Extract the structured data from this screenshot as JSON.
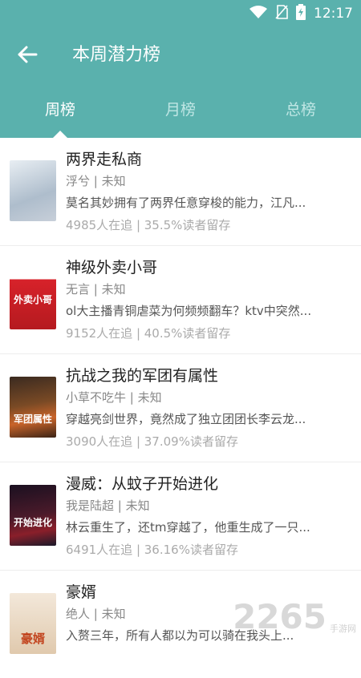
{
  "status_bar": {
    "time": "12:17",
    "icons": [
      "wifi-icon",
      "no-sim-icon",
      "battery-charging-icon"
    ]
  },
  "header": {
    "title": "本周潜力榜",
    "back_icon": "back-arrow-icon"
  },
  "tabs": [
    {
      "label": "周榜",
      "active": true
    },
    {
      "label": "月榜",
      "active": false
    },
    {
      "label": "总榜",
      "active": false
    }
  ],
  "books": [
    {
      "title": "两界走私商",
      "author": "浮兮 | 未知",
      "desc": "莫名其妙拥有了两界任意穿梭的能力，江凡...",
      "stats": "4985人在追 |  35.5%读者留存",
      "cover_text": "",
      "cover_color": "#c9d3dc"
    },
    {
      "title": "神级外卖小哥",
      "author": "无言 | 未知",
      "desc": "ol大主播青铜虐菜为何频频翻车？ktv中突然...",
      "stats": "9152人在追 |  40.5%读者留存",
      "cover_text": "外卖小哥",
      "cover_color": "#d7222a"
    },
    {
      "title": "抗战之我的军团有属性",
      "author": "小草不吃牛 | 未知",
      "desc": "穿越亮剑世界，竟然成了独立团团长李云龙...",
      "stats": "3090人在追 |  37.09%读者留存",
      "cover_text": "军团属性",
      "cover_color": "#5a3a22"
    },
    {
      "title": "漫威：从蚊子开始进化",
      "author": "我是陆超 | 未知",
      "desc": "林云重生了，还tm穿越了，他重生成了一只...",
      "stats": "6491人在追 |  36.16%读者留存",
      "cover_text": "开始进化",
      "cover_color": "#2a1a2e"
    },
    {
      "title": "豪婿",
      "author": "绝人 | 未知",
      "desc": "入赘三年，所有人都以为可以骑在我头上...",
      "stats": "",
      "cover_text": "豪婿",
      "cover_color": "#e9d9c6"
    }
  ],
  "watermark": {
    "number": "2265",
    "sub1": "手游网",
    "sub2": ""
  },
  "colors": {
    "primary": "#5ab1ad"
  }
}
